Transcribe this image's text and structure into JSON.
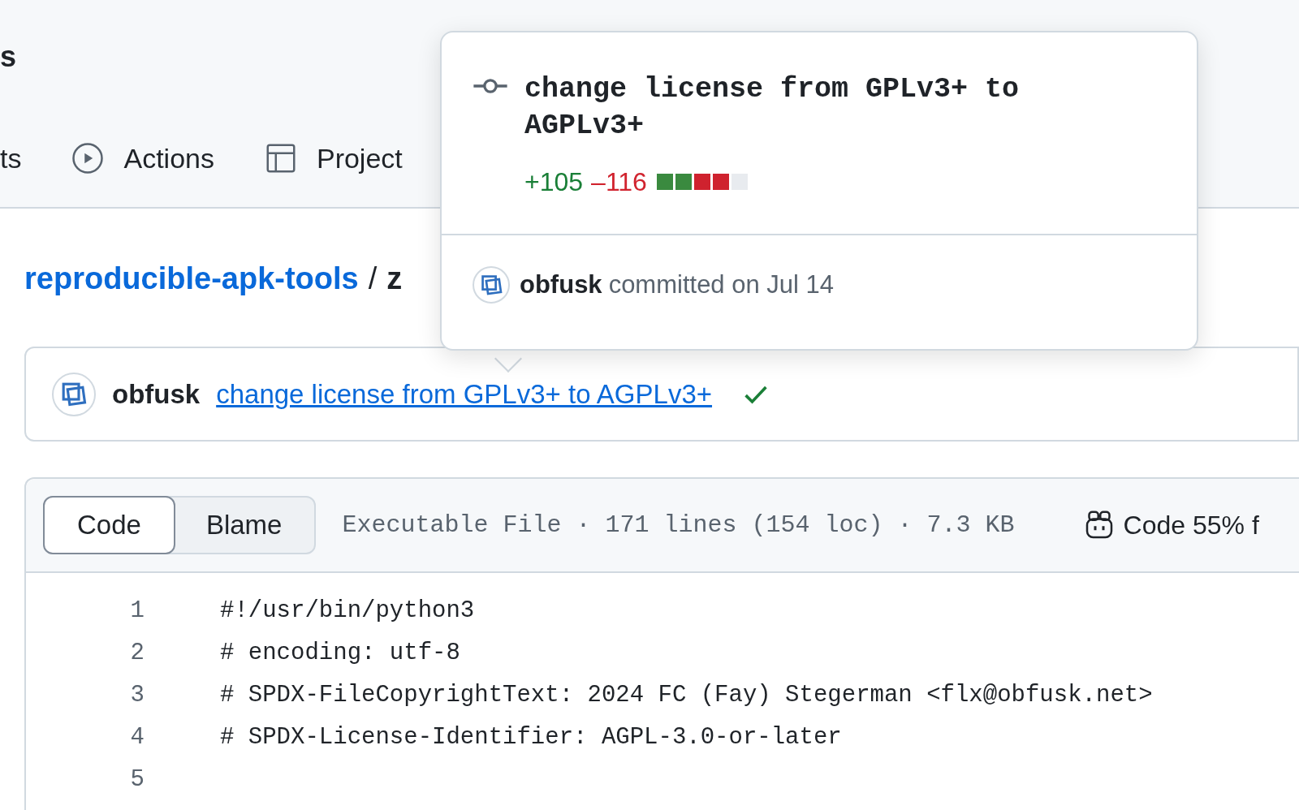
{
  "repo_header": {
    "title_fragment": "s",
    "tabs": [
      {
        "label": "ts",
        "kind": "none"
      },
      {
        "label": "Actions",
        "kind": "play"
      },
      {
        "label": "Project",
        "kind": "table"
      }
    ]
  },
  "breadcrumb": {
    "repo": "reproducible-apk-tools",
    "separator": "/",
    "file_fragment": "z"
  },
  "latest_commit": {
    "author": "obfusk",
    "message": "change license from GPLv3+ to AGPLv3+",
    "checks_passed": true
  },
  "file": {
    "view_tabs": [
      {
        "label": "Code",
        "selected": true
      },
      {
        "label": "Blame",
        "selected": false
      }
    ],
    "meta": "Executable File · 171 lines (154 loc) · 7.3 KB",
    "copilot_label": "Code 55% f",
    "lines": [
      {
        "number": "1",
        "code": "#!/usr/bin/python3"
      },
      {
        "number": "2",
        "code": "# encoding: utf-8"
      },
      {
        "number": "3",
        "code": "# SPDX-FileCopyrightText: 2024 FC (Fay) Stegerman <flx@obfusk.net>"
      },
      {
        "number": "4",
        "code": "# SPDX-License-Identifier: AGPL-3.0-or-later"
      },
      {
        "number": "5"
      }
    ]
  },
  "commit_popover": {
    "title": "change license from GPLv3+ to AGPLv3+",
    "additions": "+105",
    "deletions": "–116",
    "diffstat": [
      {
        "kind": "added"
      },
      {
        "kind": "added"
      },
      {
        "kind": "deleted"
      },
      {
        "kind": "deleted"
      },
      {
        "kind": "neutral"
      }
    ],
    "author": "obfusk",
    "action": "committed on Jul 14"
  }
}
